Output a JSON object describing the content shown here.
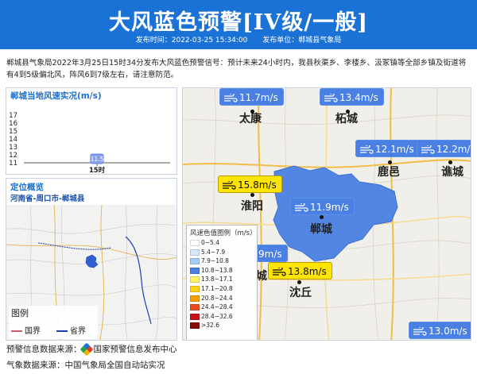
{
  "header": {
    "title": "大风蓝色预警[IV级/一般]",
    "publish_time": "发布时间：2022-03-25 15:34:00",
    "publisher": "发布单位：郸城县气象局"
  },
  "notice": "郸城县气象局2022年3月25日15时34分发布大风蓝色预警信号：预计未来24小时内，我县秋渠乡、李楼乡、汲冢镇等全部乡镇及街道将有4到5级偏北风，阵风6到7级左右，请注意防范。",
  "wind_panel": {
    "title": "郸城当地风速实况(m/s)",
    "chart_data": {
      "type": "scatter",
      "categories": [
        "15时"
      ],
      "values": [
        11.5
      ],
      "yticks": [
        17,
        16,
        15,
        14,
        13,
        12,
        11
      ],
      "ylim": [
        11,
        17
      ],
      "point_label": "11.5"
    }
  },
  "location_panel": {
    "title": "定位概览",
    "subtitle": "河南省-周口市-郸城县",
    "legend_title": "图例",
    "legend_items": [
      {
        "label": "国界",
        "color": "#c0606a"
      },
      {
        "label": "省界",
        "color": "#1a3fb0"
      }
    ]
  },
  "map": {
    "cities": [
      {
        "name": "太康"
      },
      {
        "name": "柘城"
      },
      {
        "name": "鹿邑"
      },
      {
        "name": "谯城"
      },
      {
        "name": "淮阳"
      },
      {
        "name": "郸城"
      },
      {
        "name": "沈丘"
      },
      {
        "name": "城"
      }
    ],
    "wind_chips": [
      {
        "value": "11.7m/s",
        "style": "blue"
      },
      {
        "value": "13.4m/s",
        "style": "blue"
      },
      {
        "value": "12.1m/s",
        "style": "blue"
      },
      {
        "value": "12.2m/",
        "style": "blue"
      },
      {
        "value": "15.8m/s",
        "style": "yellow"
      },
      {
        "value": "11.9m/s",
        "style": "blue"
      },
      {
        "value": "9m/s",
        "style": "blue"
      },
      {
        "value": "13.8m/s",
        "style": "yellow"
      },
      {
        "value": "13.0m/s",
        "style": "blue"
      }
    ],
    "legend": {
      "title": "风速色值图例（m/s）",
      "rows": [
        {
          "label": "0~5.4",
          "color": "#ffffff"
        },
        {
          "label": "5.4~7.9",
          "color": "#d6e8fb"
        },
        {
          "label": "7.9~10.8",
          "color": "#a9ccf5"
        },
        {
          "label": "10.8~13.8",
          "color": "#4a7fe3"
        },
        {
          "label": "13.8~17.1",
          "color": "#fff36a"
        },
        {
          "label": "17.1~20.8",
          "color": "#ffd21a"
        },
        {
          "label": "20.8~24.4",
          "color": "#f4a000"
        },
        {
          "label": "24.4~28.4",
          "color": "#e84c1c"
        },
        {
          "label": "28.4~32.6",
          "color": "#c8121a"
        },
        {
          "label": ">32.6",
          "color": "#8a0a0a"
        }
      ]
    }
  },
  "footer": {
    "warning_source": "预警信息数据来源：",
    "warning_source_org": "国家预警信息发布中心",
    "weather_source": "气象数据来源：中国气象局全国自动站实况"
  }
}
